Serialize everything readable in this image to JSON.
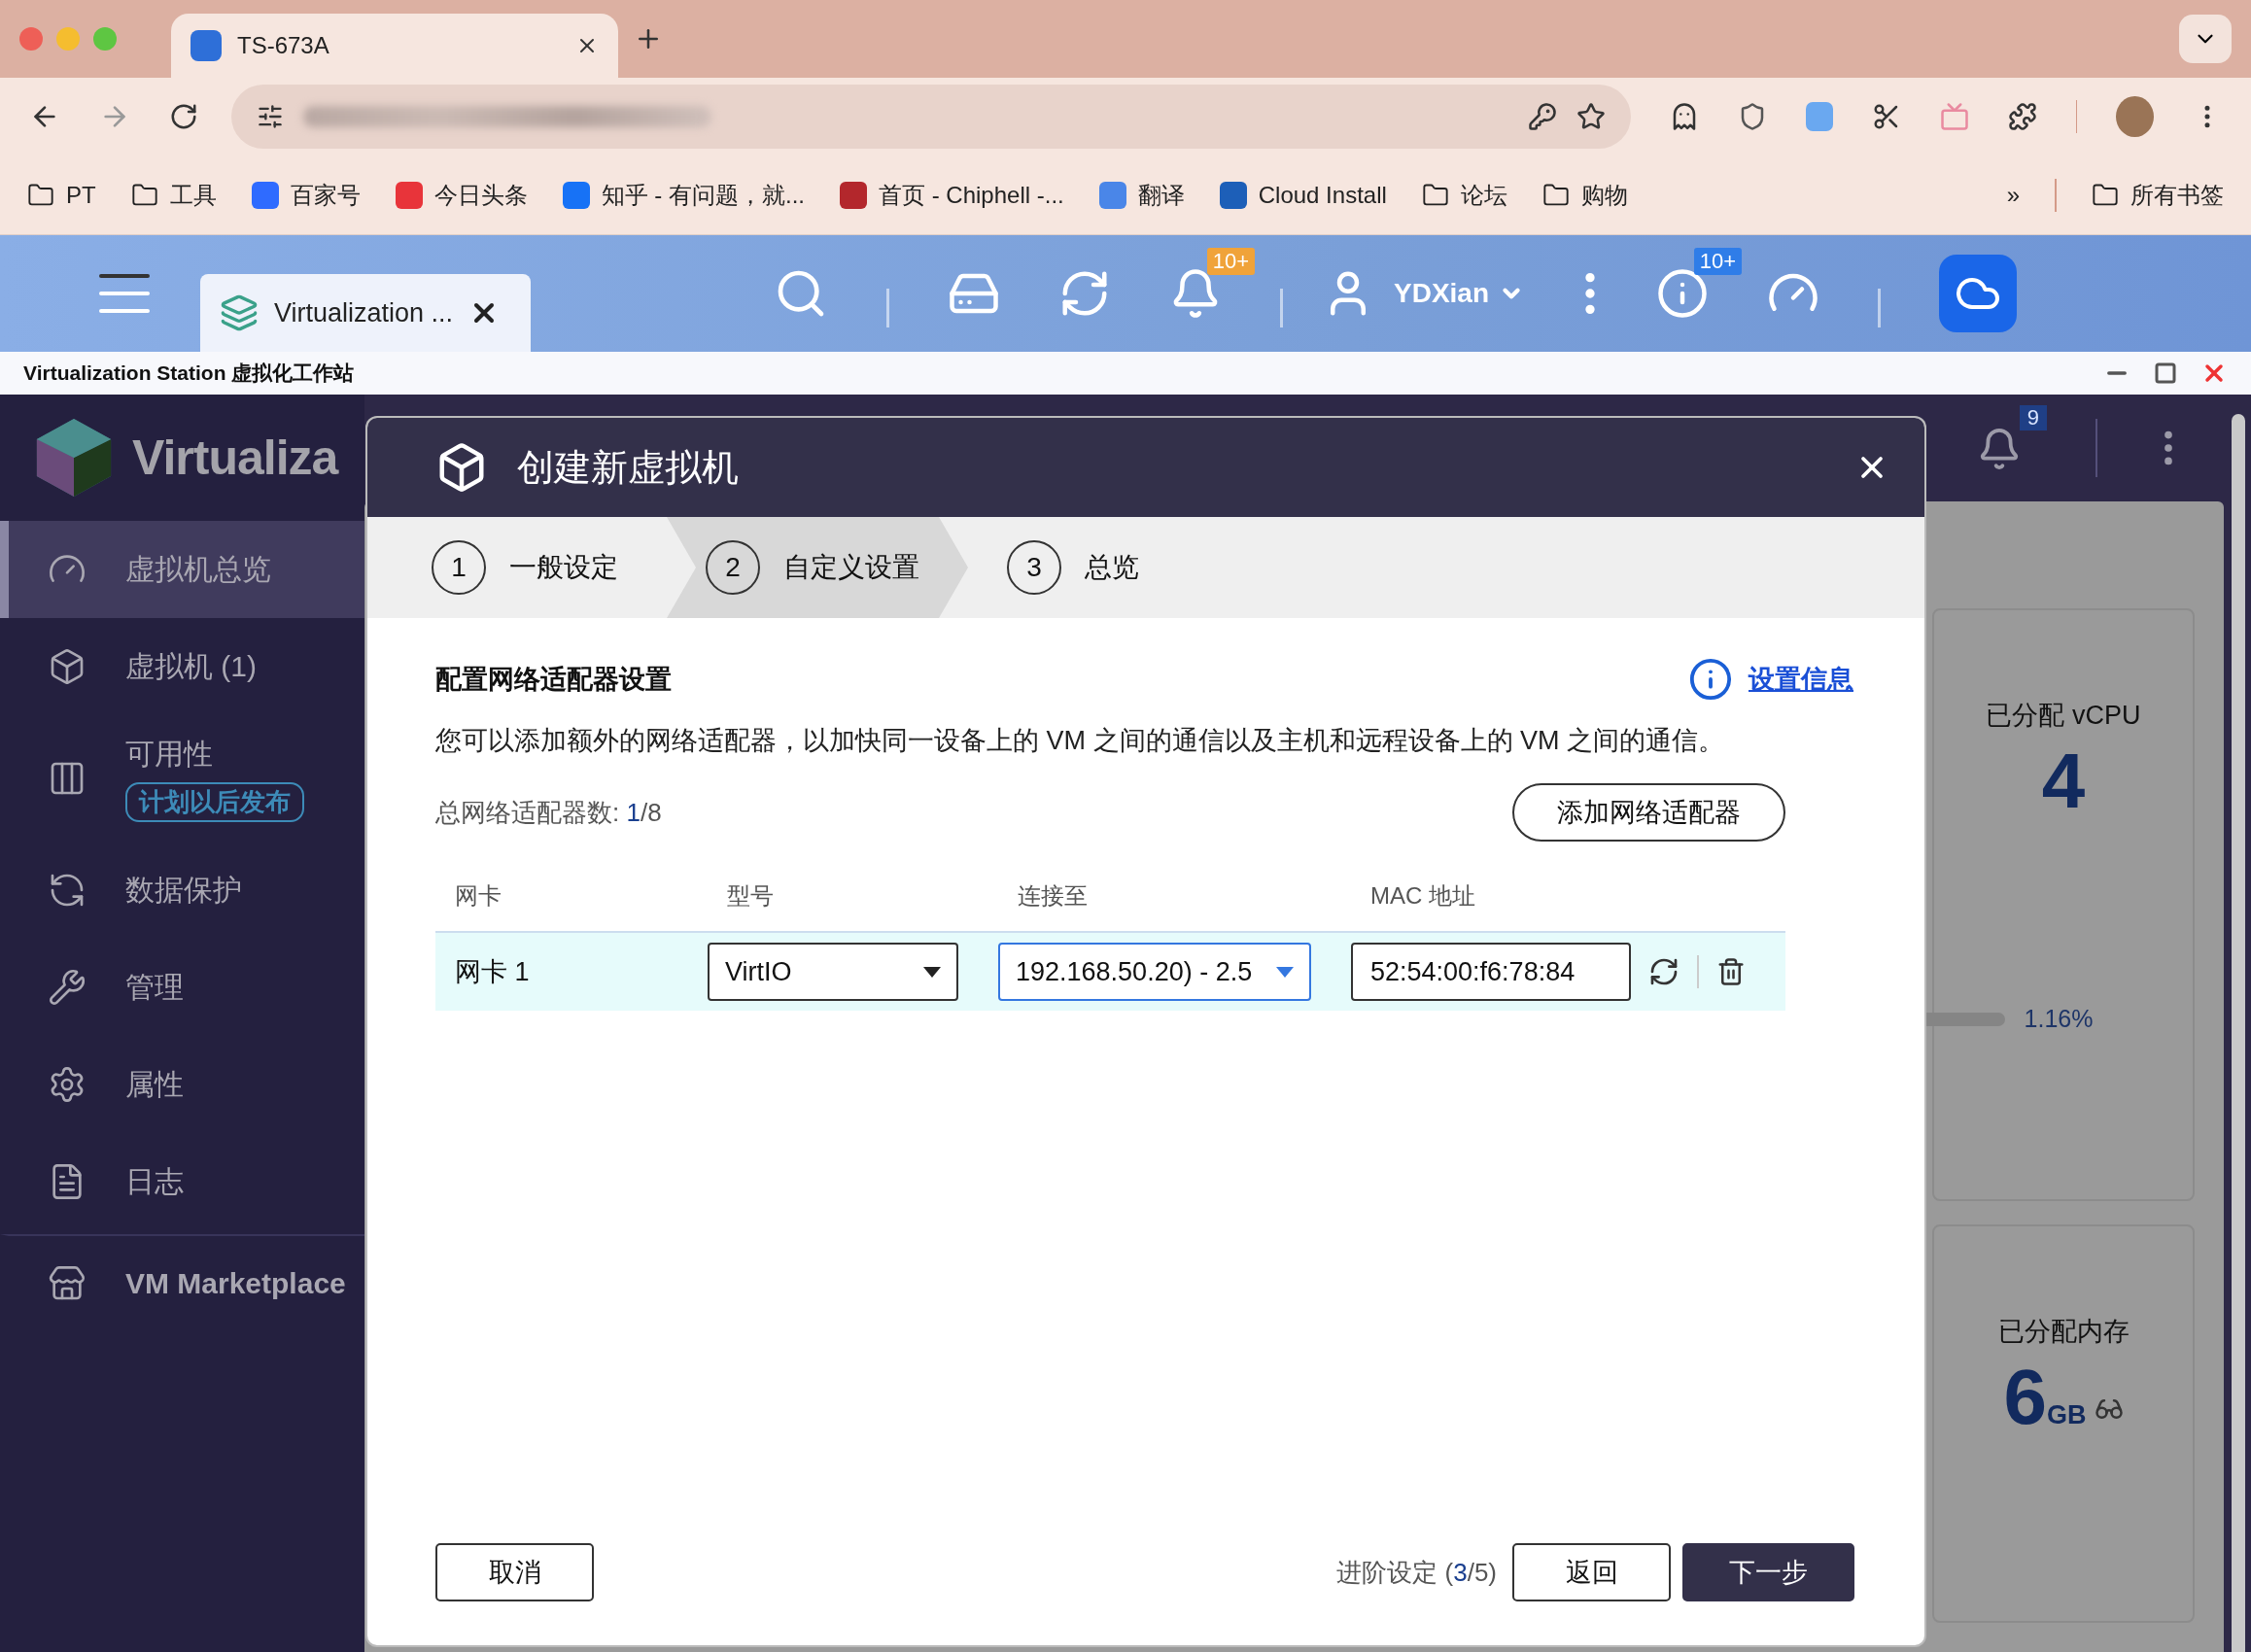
{
  "browser": {
    "tabs": [
      {
        "title": "TS-673A",
        "selected": true
      }
    ],
    "bookmarks": [
      {
        "label": "PT",
        "kind": "folder"
      },
      {
        "label": "工具",
        "kind": "folder"
      },
      {
        "label": "百家号",
        "kind": "site",
        "color": "#2f6bff"
      },
      {
        "label": "今日头条",
        "kind": "site",
        "color": "#e8343a"
      },
      {
        "label": "知乎 - 有问题，就...",
        "kind": "site",
        "color": "#1772f6"
      },
      {
        "label": "首页 - Chiphell -...",
        "kind": "site",
        "color": "#b3272c"
      },
      {
        "label": "翻译",
        "kind": "site",
        "color": "#4a86e8"
      },
      {
        "label": "Cloud Install",
        "kind": "site",
        "color": "#1d5fb8"
      },
      {
        "label": "论坛",
        "kind": "folder"
      },
      {
        "label": "购物",
        "kind": "folder"
      }
    ],
    "more": "»",
    "all_bookmarks": "所有书签"
  },
  "desktop": {
    "app_tabs": [
      {
        "label": "Virtualization ...",
        "selected": true
      }
    ],
    "notification_badge": "10+",
    "user": "YDXian",
    "info_badge": "10+"
  },
  "window": {
    "title": "Virtualization Station 虚拟化工作站"
  },
  "app": {
    "logo_text": "Virtualiza",
    "notification_count": "9",
    "sidebar": [
      {
        "label": "虚拟机总览",
        "kind": "gauge",
        "selected": true
      },
      {
        "label": "虚拟机 (1)",
        "kind": "vm",
        "selected": false
      },
      {
        "label": "可用性",
        "kind": "availability",
        "selected": false,
        "badge": "计划以后发布"
      },
      {
        "label": "数据保护",
        "kind": "protection",
        "selected": false
      },
      {
        "label": "管理",
        "kind": "wrench",
        "selected": false
      },
      {
        "label": "属性",
        "kind": "settings",
        "selected": false
      },
      {
        "label": "日志",
        "kind": "log",
        "selected": false
      },
      {
        "label": "VM Marketplace",
        "kind": "store",
        "selected": false
      }
    ],
    "cards": [
      {
        "title": "已分配 vCPU",
        "value": "4",
        "reading": "1.16%",
        "level": 0.0116
      },
      {
        "title": "已分配内存",
        "value": "6",
        "unit": "GB"
      }
    ]
  },
  "dialog": {
    "title": "创建新虚拟机",
    "steps": [
      {
        "number": "1",
        "label": "一般设定",
        "selected": false
      },
      {
        "number": "2",
        "label": "自定义设置",
        "selected": true
      },
      {
        "number": "3",
        "label": "总览",
        "selected": false
      }
    ],
    "section_title": "配置网络适配器设置",
    "info_link": "设置信息",
    "description": "您可以添加额外的网络适配器，以加快同一设备上的 VM 之间的通信以及主机和远程设备上的 VM 之间的通信。",
    "count": {
      "label": "总网络适配器数: ",
      "current": "1",
      "suffix": "/8"
    },
    "add_button": "添加网络适配器",
    "table": {
      "columns": [
        "网卡",
        "型号",
        "连接至",
        "MAC 地址"
      ],
      "rows": [
        {
          "name": "网卡 1",
          "model": {
            "value": "VirtIO",
            "focused": false
          },
          "connection": {
            "value": "192.168.50.20) - 2.5",
            "focused": true
          },
          "mac": "52:54:00:f6:78:84"
        }
      ]
    },
    "cancel": "取消",
    "progress": {
      "prefix": "进阶设定 (",
      "current": "3",
      "suffix": "/5)"
    },
    "back": "返回",
    "next": "下一步"
  }
}
